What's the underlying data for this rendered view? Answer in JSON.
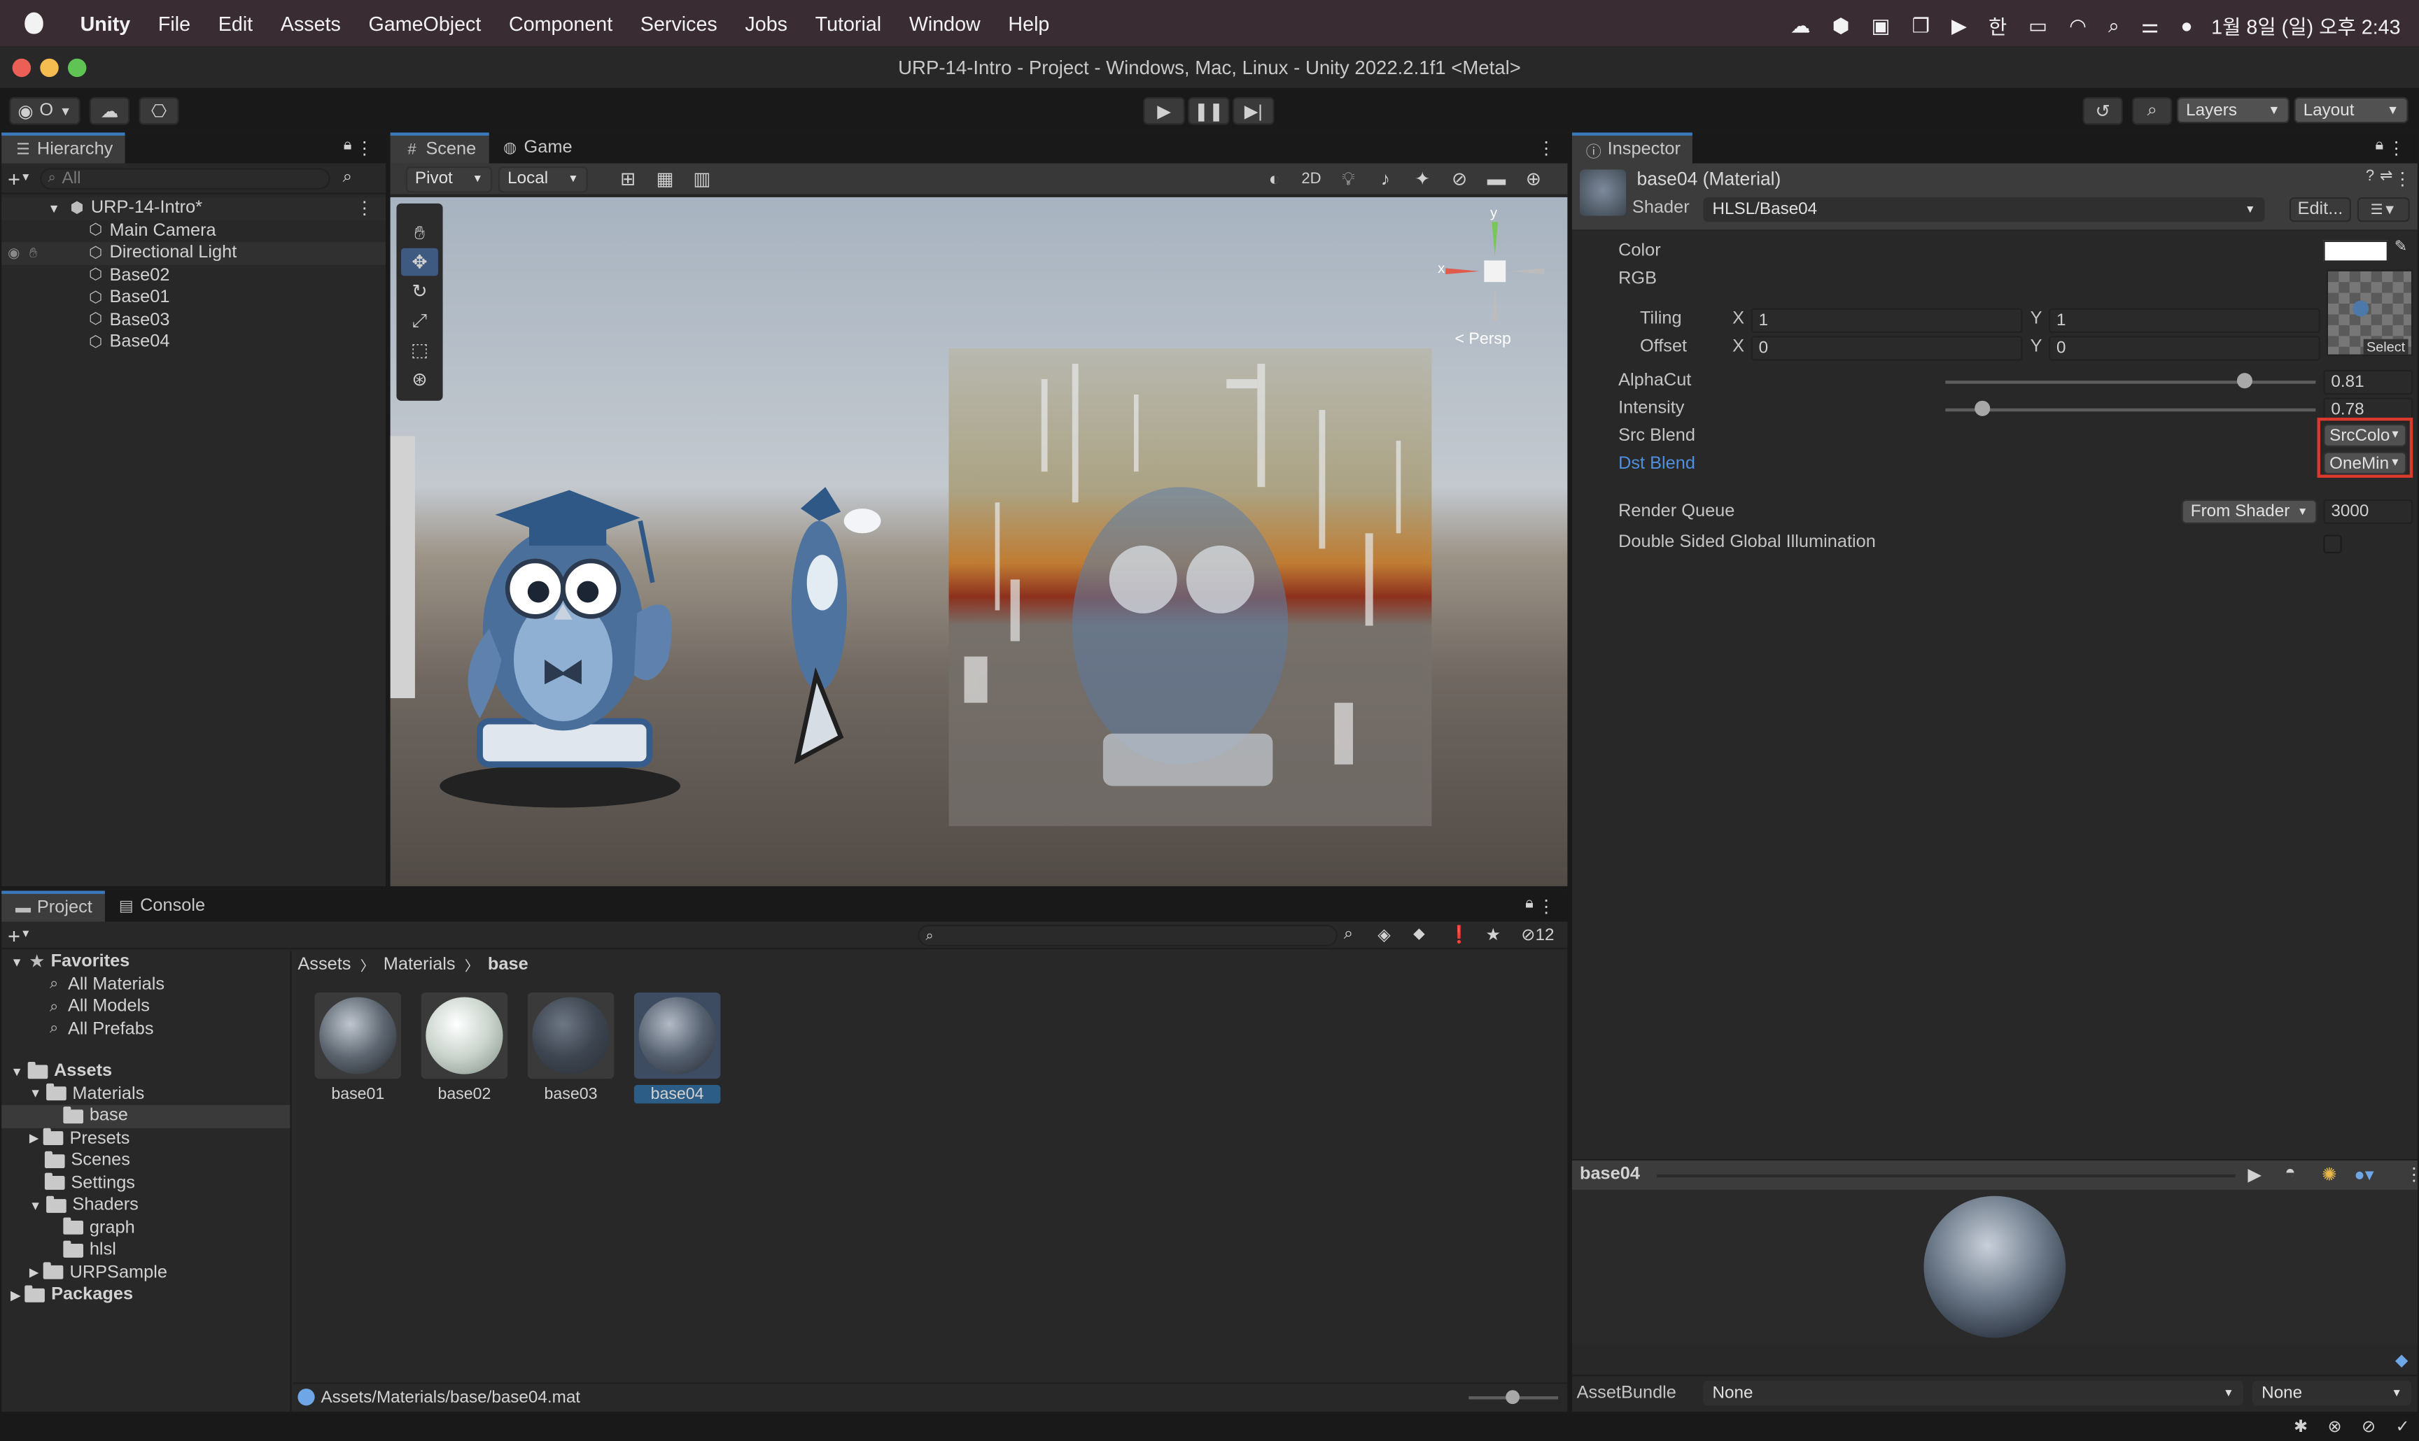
{
  "menubar": {
    "apple": "",
    "app": "Unity",
    "items": [
      "File",
      "Edit",
      "Assets",
      "GameObject",
      "Component",
      "Services",
      "Jobs",
      "Tutorial",
      "Window",
      "Help"
    ],
    "clock": "1월 8일 (일) 오후  2:43"
  },
  "window": {
    "title": "URP-14-Intro - Project - Windows, Mac, Linux - Unity 2022.2.1f1 <Metal>"
  },
  "toolbar": {
    "account_label": "O",
    "layers": "Layers",
    "layout": "Layout"
  },
  "hierarchy": {
    "tab": "Hierarchy",
    "search_placeholder": "All",
    "root": "URP-14-Intro*",
    "items": [
      "Main Camera",
      "Directional Light",
      "Base02",
      "Base01",
      "Base03",
      "Base04"
    ]
  },
  "scene": {
    "tab_scene": "Scene",
    "tab_game": "Game",
    "pivot": "Pivot",
    "local": "Local",
    "mode_2d": "2D",
    "persp": "< Persp",
    "gizmo_x": "x",
    "gizmo_y": "y"
  },
  "inspector": {
    "tab": "Inspector",
    "material_name": "base04 (Material)",
    "shader_label": "Shader",
    "shader_value": "HLSL/Base04",
    "edit_button": "Edit...",
    "props": {
      "color": "Color",
      "rgb": "RGB",
      "tiling": "Tiling",
      "offset": "Offset",
      "tiling_x": "1",
      "tiling_y": "1",
      "offset_x": "0",
      "offset_y": "0",
      "x": "X",
      "y": "Y",
      "select": "Select",
      "alphacut_label": "AlphaCut",
      "alphacut_value": "0.81",
      "alphacut_fraction": 0.81,
      "intensity_label": "Intensity",
      "intensity_value": "0.78",
      "intensity_fraction": 0.1,
      "srcblend_label": "Src Blend",
      "srcblend_value": "SrcColo",
      "dstblend_label": "Dst Blend",
      "dstblend_value": "OneMin",
      "renderqueue_label": "Render Queue",
      "renderqueue_mode": "From Shader",
      "renderqueue_value": "3000",
      "gi_label": "Double Sided Global Illumination"
    },
    "preview_title": "base04",
    "assetbundle_label": "AssetBundle",
    "assetbundle_value": "None",
    "assetbundle_variant": "None"
  },
  "project": {
    "tab_project": "Project",
    "tab_console": "Console",
    "hidden_count": "12",
    "favorites": "Favorites",
    "fav_items": [
      "All Materials",
      "All Models",
      "All Prefabs"
    ],
    "assets": "Assets",
    "tree": {
      "materials": "Materials",
      "base": "base",
      "presets": "Presets",
      "scenes": "Scenes",
      "settings": "Settings",
      "shaders": "Shaders",
      "graph": "graph",
      "hlsl": "hlsl",
      "urpsample": "URPSample"
    },
    "packages": "Packages",
    "breadcrumb": [
      "Assets",
      "Materials",
      "base"
    ],
    "files": [
      "base01",
      "base02",
      "base03",
      "base04"
    ],
    "status_path": "Assets/Materials/base/base04.mat"
  },
  "colors": {
    "accent": "#3a79bb",
    "highlight": "#d93a2b",
    "link": "#4f8fe0"
  }
}
